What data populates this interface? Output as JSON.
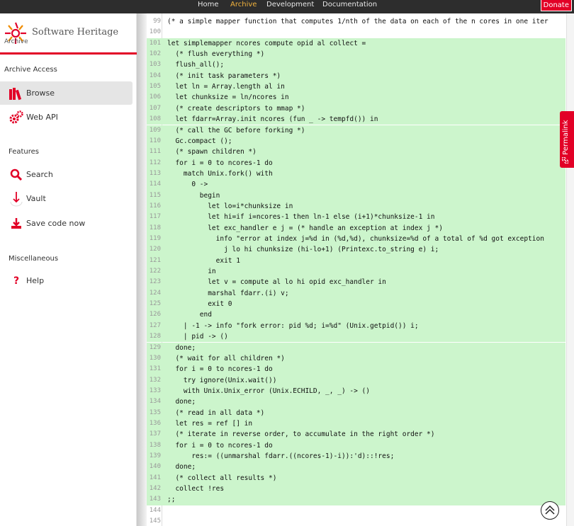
{
  "topnav": {
    "items": [
      "Home",
      "Archive",
      "Development",
      "Documentation"
    ],
    "active": "Archive",
    "donate": "Donate"
  },
  "sidebar": {
    "logo_text": "Software Heritage",
    "logo_sub": "Archive",
    "sections": {
      "archive_access": "Archive Access",
      "features": "Features",
      "misc": "Miscellaneous"
    },
    "items": {
      "browse": "Browse",
      "webapi": "Web API",
      "search": "Search",
      "vault": "Vault",
      "save": "Save code now",
      "help": "Help"
    },
    "icons": {
      "browse": "books-icon",
      "webapi": "gears-icon",
      "search": "search-icon",
      "vault": "download-arrow-icon",
      "save": "download-tray-icon",
      "help": "question-icon"
    }
  },
  "permalink": "Permalink",
  "code": {
    "highlight_from": 101,
    "highlight_to": 143,
    "lines": [
      {
        "n": "99",
        "t": "(* a simple mapper function that computes 1/nth of the data on each of the n cores in one iter"
      },
      {
        "n": "100",
        "t": ""
      },
      {
        "n": "101",
        "t": "let simplemapper ncores compute opid al collect ="
      },
      {
        "n": "102",
        "t": "  (* flush everything *)"
      },
      {
        "n": "103",
        "t": "  flush_all();"
      },
      {
        "n": "104",
        "t": "  (* init task parameters *)"
      },
      {
        "n": "105",
        "t": "  let ln = Array.length al in"
      },
      {
        "n": "106",
        "t": "  let chunksize = ln/ncores in"
      },
      {
        "n": "107",
        "t": "  (* create descriptors to mmap *)"
      },
      {
        "n": "108",
        "t": "  let fdarr=Array.init ncores (fun _ -> tempfd()) in"
      },
      {
        "n": "109",
        "t": "  (* call the GC before forking *)"
      },
      {
        "n": "110",
        "t": "  Gc.compact ();"
      },
      {
        "n": "111",
        "t": "  (* spawn children *)"
      },
      {
        "n": "112",
        "t": "  for i = 0 to ncores-1 do"
      },
      {
        "n": "113",
        "t": "    match Unix.fork() with"
      },
      {
        "n": "114",
        "t": "      0 ->"
      },
      {
        "n": "115",
        "t": "        begin"
      },
      {
        "n": "116",
        "t": "          let lo=i*chunksize in"
      },
      {
        "n": "117",
        "t": "          let hi=if i=ncores-1 then ln-1 else (i+1)*chunksize-1 in"
      },
      {
        "n": "118",
        "t": "          let exc_handler e j = (* handle an exception at index j *)"
      },
      {
        "n": "119",
        "t": "            info \"error at index j=%d in (%d,%d), chunksize=%d of a total of %d got exception"
      },
      {
        "n": "120",
        "t": "              j lo hi chunksize (hi-lo+1) (Printexc.to_string e) i;"
      },
      {
        "n": "121",
        "t": "            exit 1"
      },
      {
        "n": "122",
        "t": "          in"
      },
      {
        "n": "123",
        "t": "          let v = compute al lo hi opid exc_handler in"
      },
      {
        "n": "124",
        "t": "          marshal fdarr.(i) v;"
      },
      {
        "n": "125",
        "t": "          exit 0"
      },
      {
        "n": "126",
        "t": "        end"
      },
      {
        "n": "127",
        "t": "    | -1 -> info \"fork error: pid %d; i=%d\" (Unix.getpid()) i;"
      },
      {
        "n": "128",
        "t": "    | pid -> ()"
      },
      {
        "n": "129",
        "t": "  done;"
      },
      {
        "n": "130",
        "t": "  (* wait for all children *)"
      },
      {
        "n": "131",
        "t": "  for i = 0 to ncores-1 do"
      },
      {
        "n": "132",
        "t": "    try ignore(Unix.wait())"
      },
      {
        "n": "133",
        "t": "    with Unix.Unix_error (Unix.ECHILD, _, _) -> ()"
      },
      {
        "n": "134",
        "t": "  done;"
      },
      {
        "n": "135",
        "t": "  (* read in all data *)"
      },
      {
        "n": "136",
        "t": "  let res = ref [] in"
      },
      {
        "n": "137",
        "t": "  (* iterate in reverse order, to accumulate in the right order *)"
      },
      {
        "n": "138",
        "t": "  for i = 0 to ncores-1 do"
      },
      {
        "n": "139",
        "t": "      res:= ((unmarshal fdarr.((ncores-1)-i)):'d)::!res;"
      },
      {
        "n": "140",
        "t": "  done;"
      },
      {
        "n": "141",
        "t": "  (* collect all results *)"
      },
      {
        "n": "142",
        "t": "  collect !res"
      },
      {
        "n": "143",
        "t": ";;"
      },
      {
        "n": "144",
        "t": ""
      },
      {
        "n": "145",
        "t": ""
      }
    ]
  }
}
